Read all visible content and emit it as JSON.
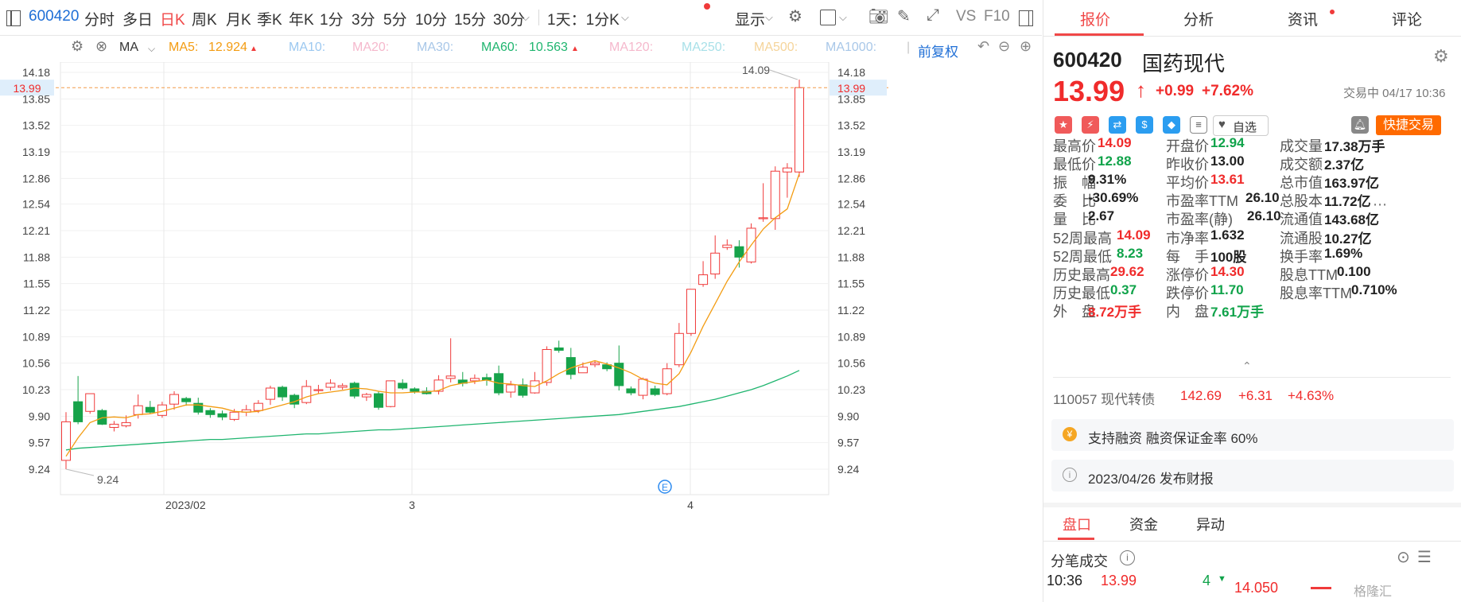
{
  "toolbar": {
    "code": "600420",
    "items": [
      "分时",
      "多日",
      "日K",
      "周K",
      "月K",
      "季K",
      "年K",
      "1分",
      "3分",
      "5分",
      "10分",
      "15分",
      "30分"
    ],
    "active": "日K",
    "interval": "1天：1分K",
    "display": "显示",
    "vs": "VS",
    "f10": "F10"
  },
  "ma": {
    "type": "MA",
    "ma5_label": "MA5:",
    "ma5_value": "12.924",
    "ma10_label": "MA10:",
    "ma20_label": "MA20:",
    "ma30_label": "MA30:",
    "ma60_label": "MA60:",
    "ma60_value": "10.563",
    "ma120_label": "MA120:",
    "ma250_label": "MA250:",
    "ma500_label": "MA500:",
    "ma1000_label": "MA1000:",
    "adjust": "前复权",
    "colors": {
      "ma5": "#f39c12",
      "ma60": "#1fb56f",
      "up": "#f03a3a",
      "down": "#16a34a"
    }
  },
  "chart_data": {
    "type": "candlestick",
    "y_ticks": [
      "14.18",
      "13.85",
      "13.52",
      "13.19",
      "12.86",
      "12.54",
      "12.21",
      "11.88",
      "11.55",
      "11.22",
      "10.89",
      "10.56",
      "10.23",
      "9.90",
      "9.57",
      "9.24"
    ],
    "ylim": [
      9.24,
      14.18
    ],
    "x_labels": [
      "2023/02",
      "3",
      "4"
    ],
    "current_price_label": "13.99",
    "high_annotation": "14.09",
    "low_annotation": "9.24",
    "ohlc": [
      [
        9.35,
        9.83,
        9.24,
        9.95
      ],
      [
        10.08,
        9.83,
        9.8,
        10.4
      ],
      [
        9.96,
        10.18,
        9.93,
        10.18
      ],
      [
        9.97,
        9.8,
        9.79,
        9.99
      ],
      [
        9.76,
        9.8,
        9.71,
        9.84
      ],
      [
        9.78,
        9.82,
        9.76,
        9.91
      ],
      [
        9.92,
        10.03,
        9.87,
        10.17
      ],
      [
        10.01,
        9.95,
        9.93,
        10.09
      ],
      [
        9.91,
        10.04,
        9.88,
        10.08
      ],
      [
        10.05,
        10.17,
        9.98,
        10.21
      ],
      [
        10.12,
        10.08,
        10.03,
        10.14
      ],
      [
        10.06,
        9.95,
        9.92,
        10.13
      ],
      [
        9.97,
        9.92,
        9.88,
        10.0
      ],
      [
        9.93,
        9.89,
        9.85,
        9.97
      ],
      [
        9.86,
        9.95,
        9.84,
        9.99
      ],
      [
        9.95,
        9.98,
        9.9,
        10.04
      ],
      [
        9.97,
        10.06,
        9.94,
        10.1
      ],
      [
        10.11,
        10.25,
        10.04,
        10.28
      ],
      [
        10.26,
        10.14,
        10.09,
        10.28
      ],
      [
        10.16,
        10.05,
        10.0,
        10.18
      ],
      [
        10.07,
        10.27,
        10.05,
        10.35
      ],
      [
        10.23,
        10.23,
        10.18,
        10.29
      ],
      [
        10.26,
        10.31,
        10.22,
        10.36
      ],
      [
        10.26,
        10.28,
        10.23,
        10.31
      ],
      [
        10.31,
        10.15,
        10.12,
        10.33
      ],
      [
        10.14,
        10.17,
        10.09,
        10.19
      ],
      [
        10.18,
        10.01,
        9.98,
        10.21
      ],
      [
        10.02,
        10.34,
        10.01,
        10.34
      ],
      [
        10.31,
        10.25,
        10.23,
        10.36
      ],
      [
        10.24,
        10.21,
        10.18,
        10.26
      ],
      [
        10.21,
        10.18,
        10.17,
        10.26
      ],
      [
        10.21,
        10.35,
        10.17,
        10.41
      ],
      [
        10.37,
        10.4,
        10.32,
        10.87
      ],
      [
        10.35,
        10.31,
        10.27,
        10.45
      ],
      [
        10.34,
        10.37,
        10.3,
        10.42
      ],
      [
        10.38,
        10.35,
        10.28,
        10.43
      ],
      [
        10.43,
        10.19,
        10.16,
        10.53
      ],
      [
        10.2,
        10.29,
        10.13,
        10.34
      ],
      [
        10.29,
        10.16,
        10.13,
        10.37
      ],
      [
        10.19,
        10.34,
        10.18,
        10.45
      ],
      [
        10.32,
        10.73,
        10.28,
        10.77
      ],
      [
        10.75,
        10.72,
        10.69,
        10.84
      ],
      [
        10.63,
        10.42,
        10.36,
        10.75
      ],
      [
        10.44,
        10.51,
        10.44,
        10.57
      ],
      [
        10.54,
        10.56,
        10.51,
        10.59
      ],
      [
        10.54,
        10.49,
        10.46,
        10.57
      ],
      [
        10.56,
        10.28,
        10.22,
        10.78
      ],
      [
        10.24,
        10.19,
        10.16,
        10.27
      ],
      [
        10.16,
        10.36,
        10.11,
        10.38
      ],
      [
        10.24,
        10.17,
        10.15,
        10.28
      ],
      [
        10.18,
        10.49,
        10.16,
        10.56
      ],
      [
        10.54,
        10.93,
        10.51,
        11.06
      ],
      [
        10.93,
        11.48,
        10.9,
        11.48
      ],
      [
        11.54,
        11.66,
        11.51,
        11.83
      ],
      [
        11.67,
        11.93,
        11.61,
        12.15
      ],
      [
        12.0,
        12.03,
        11.97,
        12.1
      ],
      [
        12.01,
        11.88,
        11.75,
        12.09
      ],
      [
        11.82,
        12.24,
        11.8,
        12.3
      ],
      [
        12.36,
        12.37,
        12.32,
        12.8
      ],
      [
        12.36,
        12.95,
        12.22,
        13.01
      ],
      [
        12.94,
        12.99,
        12.62,
        13.05
      ],
      [
        12.94,
        13.99,
        12.88,
        14.09
      ]
    ],
    "ma5": [
      9.4,
      9.63,
      9.82,
      9.88,
      9.89,
      9.88,
      9.92,
      9.93,
      9.96,
      10.0,
      10.04,
      10.04,
      10.02,
      10.0,
      9.96,
      9.95,
      9.96,
      10.0,
      10.04,
      10.08,
      10.14,
      10.18,
      10.2,
      10.22,
      10.25,
      10.24,
      10.21,
      10.19,
      10.19,
      10.2,
      10.2,
      10.22,
      10.28,
      10.31,
      10.33,
      10.35,
      10.31,
      10.3,
      10.28,
      10.27,
      10.34,
      10.43,
      10.5,
      10.55,
      10.59,
      10.55,
      10.5,
      10.44,
      10.36,
      10.31,
      10.29,
      10.43,
      10.7,
      11.02,
      11.3,
      11.58,
      11.82,
      12.03,
      12.23,
      12.37,
      12.48,
      12.92
    ],
    "ma60": [
      9.48,
      9.5,
      9.51,
      9.52,
      9.53,
      9.54,
      9.55,
      9.56,
      9.57,
      9.58,
      9.59,
      9.6,
      9.61,
      9.61,
      9.62,
      9.63,
      9.64,
      9.65,
      9.66,
      9.67,
      9.68,
      9.68,
      9.69,
      9.7,
      9.71,
      9.72,
      9.73,
      9.73,
      9.74,
      9.75,
      9.76,
      9.77,
      9.78,
      9.79,
      9.8,
      9.81,
      9.82,
      9.83,
      9.84,
      9.85,
      9.86,
      9.87,
      9.88,
      9.89,
      9.9,
      9.91,
      9.92,
      9.94,
      9.96,
      9.98,
      10.0,
      10.02,
      10.05,
      10.08,
      10.11,
      10.15,
      10.19,
      10.23,
      10.28,
      10.34,
      10.4,
      10.47
    ]
  },
  "quote": {
    "tabs": [
      "报价",
      "分析",
      "资讯",
      "评论"
    ],
    "code": "600420",
    "name": "国药现代",
    "price": "13.99",
    "arrow": "↑",
    "change": "+0.99",
    "pct": "+7.62%",
    "status": "交易中 04/17 10:36",
    "follow": "自选",
    "quick_trade": "快捷交易",
    "rows": [
      [
        [
          "最高价",
          "14.09",
          "red"
        ],
        [
          "开盘价",
          "12.94",
          "green"
        ],
        [
          "成交量",
          "17.38万手",
          "blk"
        ]
      ],
      [
        [
          "最低价",
          "12.88",
          "green"
        ],
        [
          "昨收价",
          "13.00",
          "blk"
        ],
        [
          "成交额",
          "2.37亿",
          "blk"
        ]
      ],
      [
        [
          "振　幅",
          "9.31%",
          "blk"
        ],
        [
          "平均价",
          "13.61",
          "red"
        ],
        [
          "总市值",
          "163.97亿",
          "blk"
        ]
      ],
      [
        [
          "委　比",
          "-30.69%",
          "blk"
        ],
        [
          "市盈率TTM",
          "26.10",
          "blk"
        ],
        [
          "总股本",
          "11.72亿",
          "blk"
        ]
      ],
      [
        [
          "量　比",
          "2.67",
          "blk"
        ],
        [
          "市盈率(静)",
          "26.10",
          "blk"
        ],
        [
          "流通值",
          "143.68亿",
          "blk"
        ]
      ],
      [
        [
          "52周最高",
          "14.09",
          "red"
        ],
        [
          "市净率",
          "1.632",
          "blk"
        ],
        [
          "流通股",
          "10.27亿",
          "blk"
        ]
      ],
      [
        [
          "52周最低",
          "8.23",
          "green"
        ],
        [
          "每　手",
          "100股",
          "blk"
        ],
        [
          "换手率",
          "1.69%",
          "blk"
        ]
      ],
      [
        [
          "历史最高",
          "29.62",
          "red"
        ],
        [
          "涨停价",
          "14.30",
          "red"
        ],
        [
          "股息TTM",
          "0.100",
          "blk"
        ]
      ],
      [
        [
          "历史最低",
          "0.37",
          "green"
        ],
        [
          "跌停价",
          "11.70",
          "green"
        ],
        [
          "股息率TTM",
          "0.710%",
          "blk"
        ]
      ],
      [
        [
          "外　盘",
          "8.72万手",
          "red"
        ],
        [
          "内　盘",
          "7.61万手",
          "green"
        ]
      ]
    ],
    "bond": {
      "code_name": "110057 现代转债",
      "price": "142.69",
      "change": "+6.31",
      "pct": "+4.63%"
    },
    "margin": "支持融资 融资保证金率 60%",
    "report": "2023/04/26  发布财报",
    "bottom_tabs": [
      "盘口",
      "资金",
      "异动"
    ],
    "ticks_title": "分笔成交",
    "tick_row": {
      "time": "10:36",
      "price": "13.99",
      "vol": "4",
      "level_price": "14.050",
      "watermark": "格隆汇"
    }
  }
}
